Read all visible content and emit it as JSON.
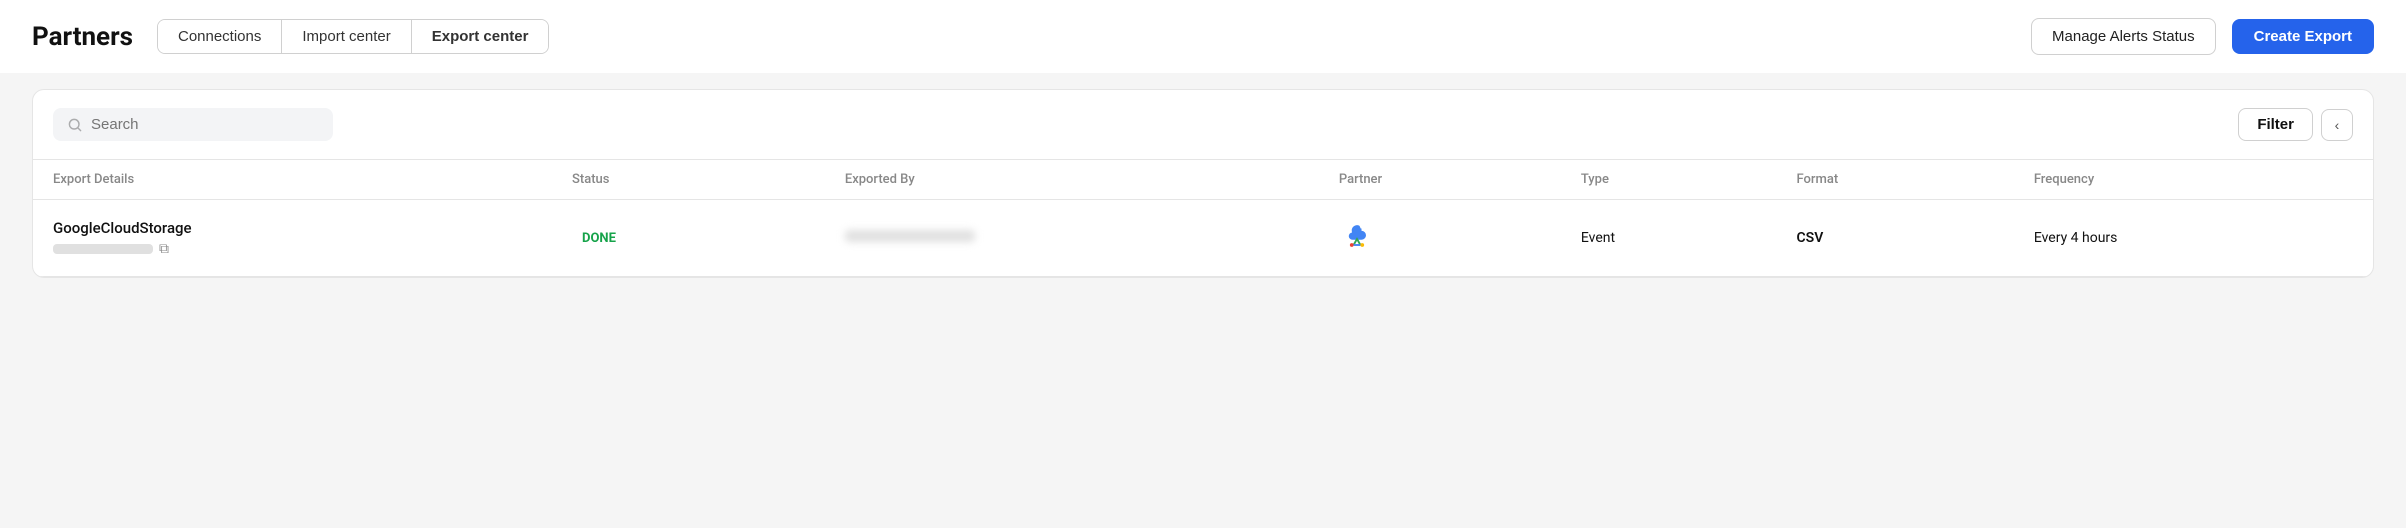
{
  "header": {
    "title": "Partners",
    "tabs": [
      {
        "label": "Connections",
        "active": false
      },
      {
        "label": "Import center",
        "active": false
      },
      {
        "label": "Export center",
        "active": true
      }
    ],
    "manage_alerts_label": "Manage Alerts Status",
    "create_export_label": "Create Export"
  },
  "search": {
    "placeholder": "Search"
  },
  "filter_label": "Filter",
  "chevron_label": "‹",
  "table": {
    "columns": [
      {
        "key": "export_details",
        "label": "Export Details"
      },
      {
        "key": "status",
        "label": "Status"
      },
      {
        "key": "exported_by",
        "label": "Exported By"
      },
      {
        "key": "partner",
        "label": "Partner"
      },
      {
        "key": "type",
        "label": "Type"
      },
      {
        "key": "format",
        "label": "Format"
      },
      {
        "key": "frequency",
        "label": "Frequency"
      }
    ],
    "rows": [
      {
        "name": "GoogleCloudStorage",
        "status": "DONE",
        "status_color": "#16a34a",
        "partner_icon": "google-cloud",
        "type": "Event",
        "format": "CSV",
        "frequency": "Every 4 hours"
      }
    ]
  }
}
